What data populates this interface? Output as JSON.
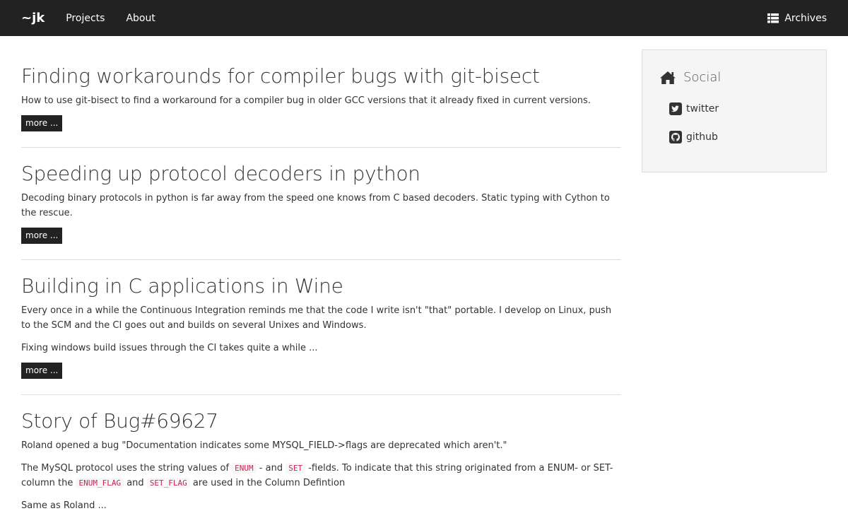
{
  "nav": {
    "brand": "~jk",
    "links": [
      "Projects",
      "About"
    ],
    "archives": "Archives"
  },
  "posts": [
    {
      "title": "Finding workarounds for compiler bugs with git-bisect",
      "paragraphs": [
        "How to use git-bisect to find a workaround for a compiler bug in older GCC versions that it already fixed in current versions."
      ],
      "more": "more ..."
    },
    {
      "title": "Speeding up protocol decoders in python",
      "paragraphs": [
        "Decoding binary protocols in python is far away from the speed one knows from C based decoders. Static typing with Cython to the rescue."
      ],
      "more": "more ..."
    },
    {
      "title": "Building in C applications in Wine",
      "paragraphs": [
        "Every once in a while the Continuous Integration reminds me that the code I write isn't \"that\" portable. I develop on Linux, push to the SCM and the CI goes out and builds on several Unixes and Windows.",
        "Fixing windows build issues through the CI takes quite a while ..."
      ],
      "more": "more ..."
    },
    {
      "title": "Story of Bug#69627",
      "p1": "Roland opened a bug \"Documentation indicates some MYSQL_FIELD->flags are deprecated which aren't.\"",
      "p2": {
        "t1": "The MySQL protocol uses the string values of ",
        "c1": "ENUM",
        "t2": " - and ",
        "c2": "SET",
        "t3": " -fields. To indicate that this string originated from a ENUM- or SET-column the ",
        "c3": "ENUM_FLAG",
        "t4": " and ",
        "c4": "SET_FLAG",
        "t5": " are used in the Column Defintion"
      },
      "p3": "Same as Roland ..."
    }
  ],
  "sidebar": {
    "heading": "Social",
    "links": [
      "twitter",
      "github"
    ]
  },
  "colors": {
    "navbar": "#222222",
    "code_text": "#c7254e",
    "sidebar_bg": "#f5f5f5"
  }
}
